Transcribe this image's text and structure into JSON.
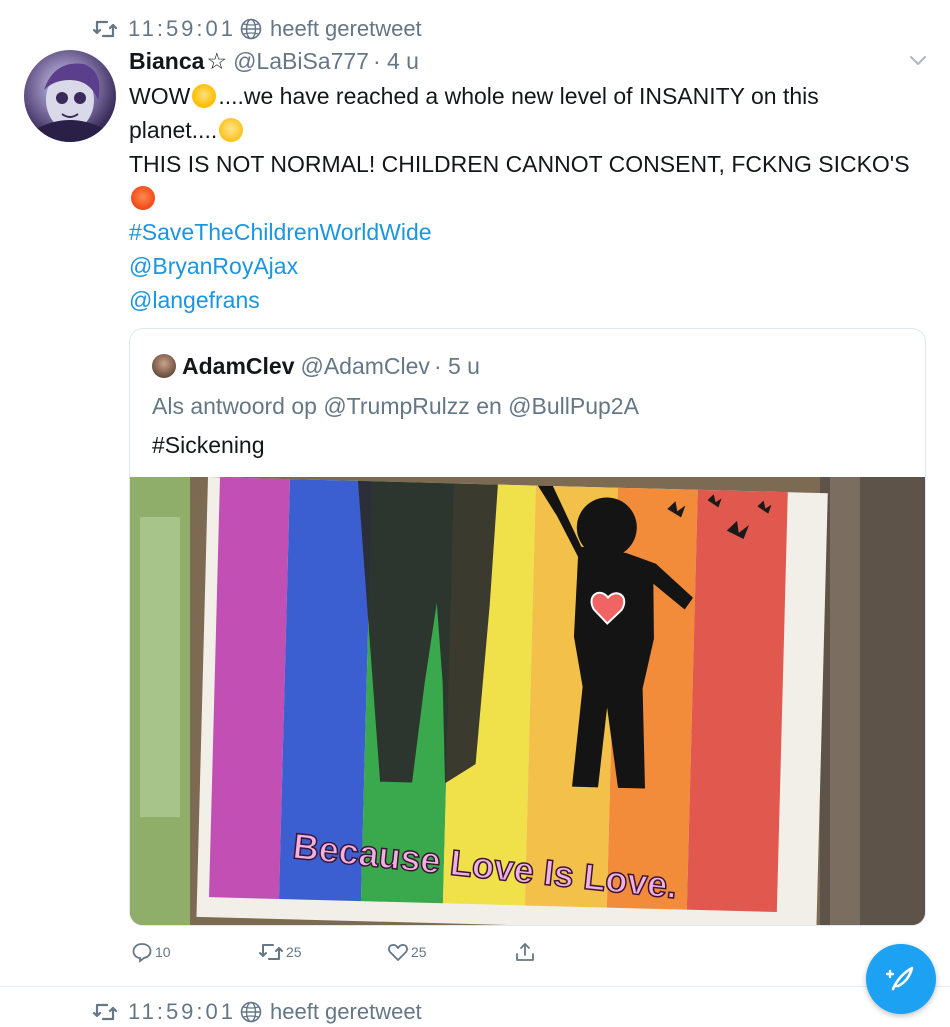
{
  "retweet_top": {
    "handle": "11:59:01",
    "label": "heeft geretweet"
  },
  "tweet": {
    "name": "Bianca",
    "name_symbol": "☆",
    "handle": "@LaBiSa777",
    "time": "· 4 u",
    "line1_a": "WOW",
    "line1_b": "....we have reached a whole new level of INSANITY on this",
    "line2": "planet....",
    "line3": "THIS IS NOT NORMAL! CHILDREN CANNOT CONSENT, FCKNG SICKO'S",
    "hashtag": "#SaveTheChildrenWorldWide",
    "mention1": "@BryanRoyAjax",
    "mention2": "@langefrans"
  },
  "quote": {
    "name": "AdamClev",
    "handle": "@AdamClev",
    "time": "· 5 u",
    "reply_prefix": "Als antwoord op",
    "reply_user1": "@TrumpRulzz",
    "reply_join": "en",
    "reply_user2": "@BullPup2A",
    "text": "#Sickening",
    "image_caption": "Because Love Is Love."
  },
  "actions": {
    "replies": "10",
    "retweets": "25",
    "likes": "25"
  },
  "retweet_bottom": {
    "handle": "11:59:01",
    "label": "heeft geretweet"
  },
  "icons": {
    "retweet": "retweet-icon",
    "globe": "globe-icon",
    "chevron": "chevron-down-icon",
    "reply": "reply-icon",
    "like": "heart-icon",
    "share": "share-icon",
    "compose": "compose-tweet-icon"
  },
  "colors": {
    "link": "#1b95e0",
    "secondary": "#657786",
    "fab": "#1da1f2"
  }
}
